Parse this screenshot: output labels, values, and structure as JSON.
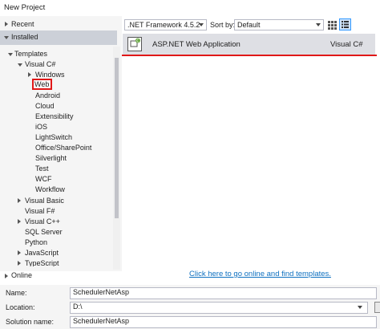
{
  "window": {
    "title": "New Project"
  },
  "tree": {
    "recent": "Recent",
    "installed": "Installed",
    "templates": "Templates",
    "visual_csharp": "Visual C#",
    "csharp_children": [
      "Windows",
      "Web",
      "Android",
      "Cloud",
      "Extensibility",
      "iOS",
      "LightSwitch",
      "Office/SharePoint",
      "Silverlight",
      "Test",
      "WCF",
      "Workflow"
    ],
    "visual_basic": "Visual Basic",
    "visual_fsharp": "Visual F#",
    "visual_cpp": "Visual C++",
    "sql_server": "SQL Server",
    "python": "Python",
    "javascript": "JavaScript",
    "typescript": "TypeScript",
    "online": "Online"
  },
  "toolbar": {
    "framework": ".NET Framework 4.5.2",
    "sort_label": "Sort by:",
    "sort_value": "Default"
  },
  "template": {
    "name": "ASP.NET Web Application",
    "language": "Visual C#"
  },
  "online_link": "Click here to go online and find templates.",
  "form": {
    "name_label": "Name:",
    "name_value": "SchedulerNetAsp",
    "location_label": "Location:",
    "location_value": "D:\\",
    "solution_label": "Solution name:",
    "solution_value": "SchedulerNetAsp"
  },
  "colors": {
    "highlight_red": "#e01818",
    "link_blue": "#0e70c0",
    "selected_row": "#ccd0d8"
  }
}
